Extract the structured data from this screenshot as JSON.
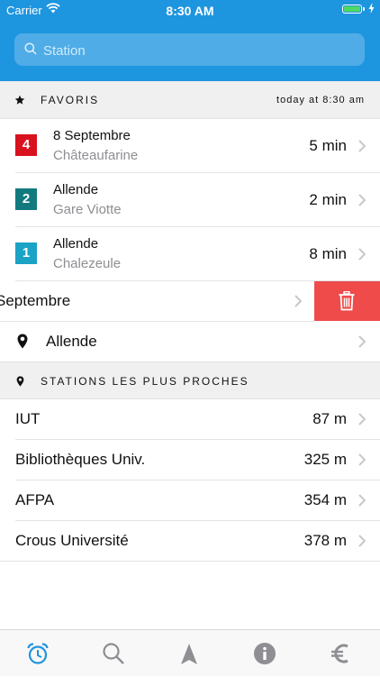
{
  "status_bar": {
    "carrier": "Carrier",
    "time": "8:30 AM"
  },
  "search": {
    "placeholder": "Station"
  },
  "favorites_section": {
    "title": "FAVORIS",
    "updated": "today at 8:30 am"
  },
  "favorites": [
    {
      "line": "4",
      "line_color": "#d9121f",
      "stop": "8 Septembre",
      "direction": "Châteaufarine",
      "time": "5 min"
    },
    {
      "line": "2",
      "line_color": "#127a7e",
      "stop": "Allende",
      "direction": "Gare Viotte",
      "time": "2 min"
    },
    {
      "line": "1",
      "line_color": "#1ba3c6",
      "stop": "Allende",
      "direction": "Chalezeule",
      "time": "8 min"
    }
  ],
  "swiped_row": {
    "label": "Septembre",
    "action_icon": "trash-icon",
    "action_color": "#ef4b4b"
  },
  "place_row": {
    "label": "Allende",
    "icon": "pin-icon"
  },
  "nearby_section": {
    "title": "STATIONS LES PLUS PROCHES"
  },
  "nearby": [
    {
      "name": "IUT",
      "distance": "87 m"
    },
    {
      "name": "Bibliothèques Univ.",
      "distance": "325 m"
    },
    {
      "name": "AFPA",
      "distance": "354 m"
    },
    {
      "name": "Crous Université",
      "distance": "378 m"
    }
  ],
  "tabs": [
    {
      "icon": "alarm-clock-icon",
      "active": true
    },
    {
      "icon": "search-icon",
      "active": false
    },
    {
      "icon": "navigation-arrow-icon",
      "active": false
    },
    {
      "icon": "info-icon",
      "active": false
    },
    {
      "icon": "euro-icon",
      "active": false
    }
  ],
  "colors": {
    "header": "#1e95df",
    "tab_active": "#1e95df",
    "tab_inactive": "#8e8e93"
  }
}
